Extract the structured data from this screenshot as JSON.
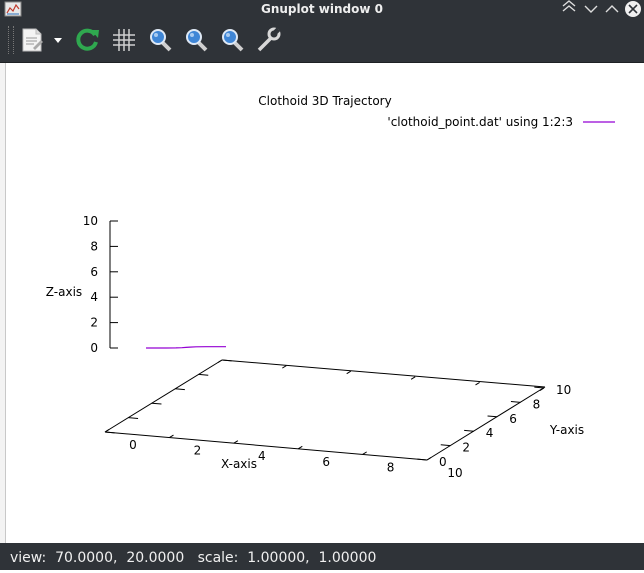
{
  "window": {
    "title": "Gnuplot window 0"
  },
  "toolbar": {
    "items": [
      {
        "name": "export-icon"
      },
      {
        "name": "dropdown-arrow-icon"
      },
      {
        "name": "replot-icon"
      },
      {
        "name": "grid-icon"
      },
      {
        "name": "zoom-previous-icon"
      },
      {
        "name": "zoom-next-icon"
      },
      {
        "name": "unzoom-icon"
      },
      {
        "name": "settings-wrench-icon"
      }
    ]
  },
  "status": {
    "text": "view:  70.0000,  20.0000   scale:  1.00000,  1.00000"
  },
  "colors": {
    "chrome": "#2f3338",
    "series": "#9400d3",
    "replot_green": "#2fa84f",
    "zoom_blue": "#3f86d6"
  },
  "chart_data": {
    "type": "line",
    "title": "Clothoid 3D Trajectory",
    "xlabel": "X-axis",
    "ylabel": "Y-axis",
    "zlabel": "Z-axis",
    "xlim": [
      0,
      10
    ],
    "ylim": [
      0,
      10
    ],
    "zlim": [
      0,
      10
    ],
    "x_ticks": [
      "0",
      "2",
      "4",
      "6",
      "8",
      "10"
    ],
    "y_ticks": [
      "0",
      "2",
      "4",
      "6",
      "8",
      "10"
    ],
    "z_ticks": [
      "0",
      "2",
      "4",
      "6",
      "8",
      "10"
    ],
    "view": [
      70,
      20
    ],
    "legend": "top-right",
    "grid": false,
    "series": [
      {
        "name": "'clothoid_point.dat' using 1:2:3",
        "x": [
          0.0,
          0.5,
          1.0,
          1.5,
          1.8,
          2.0,
          2.2,
          2.5,
          3.0,
          3.5,
          4.0
        ],
        "y": [
          0.0,
          0.0,
          0.02,
          0.1,
          0.3,
          0.6,
          0.9,
          1.1,
          1.2,
          1.22,
          1.23
        ],
        "z": [
          0,
          0,
          0,
          0,
          0,
          0,
          0,
          0,
          0,
          0,
          0
        ]
      }
    ]
  }
}
